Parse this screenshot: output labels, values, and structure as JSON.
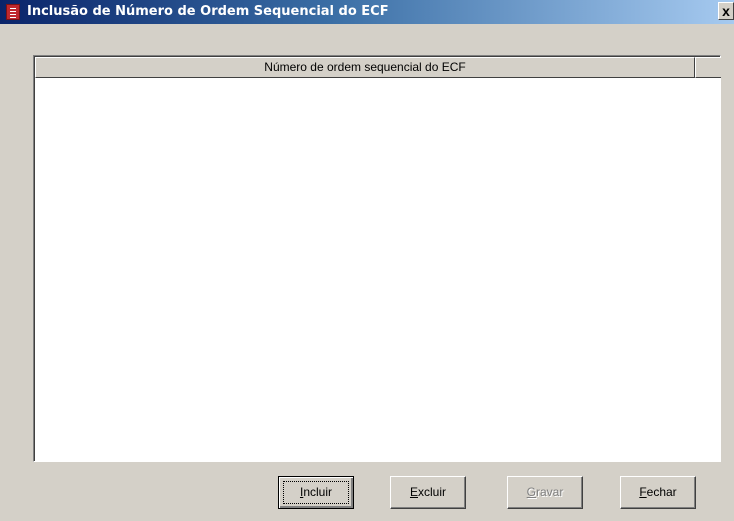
{
  "window": {
    "title": "Inclusão de Número de Ordem Sequencial do ECF",
    "close_label": "x"
  },
  "grid": {
    "columns": [
      "Número de ordem sequencial do ECF"
    ],
    "rows": []
  },
  "buttons": {
    "incluir": "Incluir",
    "excluir": "Excluir",
    "gravar": "Gravar",
    "fechar": "Fechar"
  }
}
